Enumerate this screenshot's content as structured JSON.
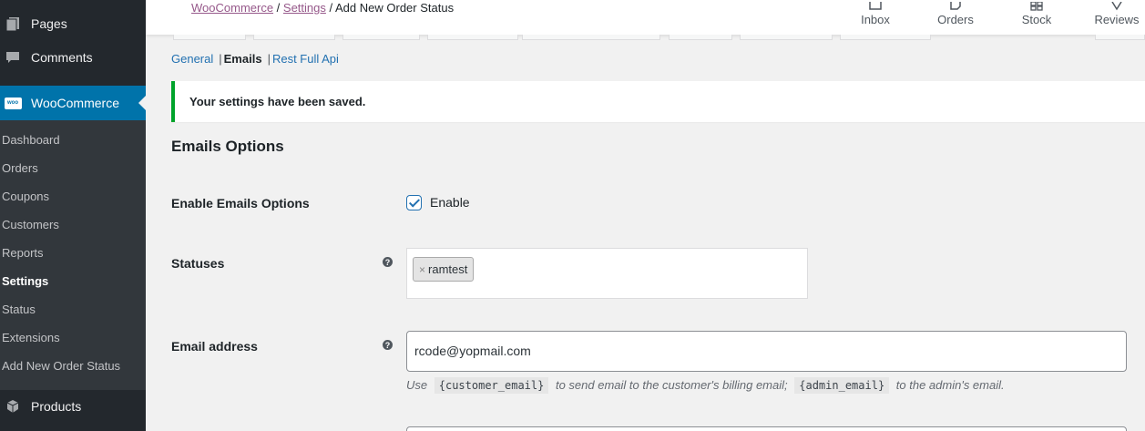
{
  "sidebar": {
    "pages": "Pages",
    "comments": "Comments",
    "woocommerce": "WooCommerce",
    "woo_logo": "woo",
    "products": "Products",
    "submenu": [
      "Dashboard",
      "Orders",
      "Coupons",
      "Customers",
      "Reports",
      "Settings",
      "Status",
      "Extensions",
      "Add New Order Status"
    ],
    "current": "Settings"
  },
  "header": {
    "breadcrumb": {
      "link1": "WooCommerce",
      "sep1": " / ",
      "link2": "Settings",
      "sep2": " / ",
      "current": "Add New Order Status"
    },
    "buttons": {
      "inbox": "Inbox",
      "orders": "Orders",
      "stock": "Stock",
      "reviews": "Reviews"
    }
  },
  "subnav": {
    "general": "General",
    "emails": "Emails",
    "rest": "Rest Full Api",
    "sep": "|"
  },
  "notice": "Your settings have been saved.",
  "section_title": "Emails Options",
  "form": {
    "enable_label": "Enable Emails Options",
    "enable_text": "Enable",
    "statuses_label": "Statuses",
    "status_chip": "ramtest",
    "chip_remove": "×",
    "email_label": "Email address",
    "email_value": "rcode@yopmail.com",
    "help": "?",
    "desc": {
      "use": "Use",
      "code1": "{customer_email}",
      "mid": "to send email to the customer's billing email;",
      "code2": "{admin_email}",
      "end": "to the admin's email."
    }
  },
  "colors": {
    "accent": "#2271b1",
    "woo_blue": "#0073aa",
    "link_purple": "#96588a",
    "success": "#00a32a",
    "sidebar": "#23282d"
  }
}
